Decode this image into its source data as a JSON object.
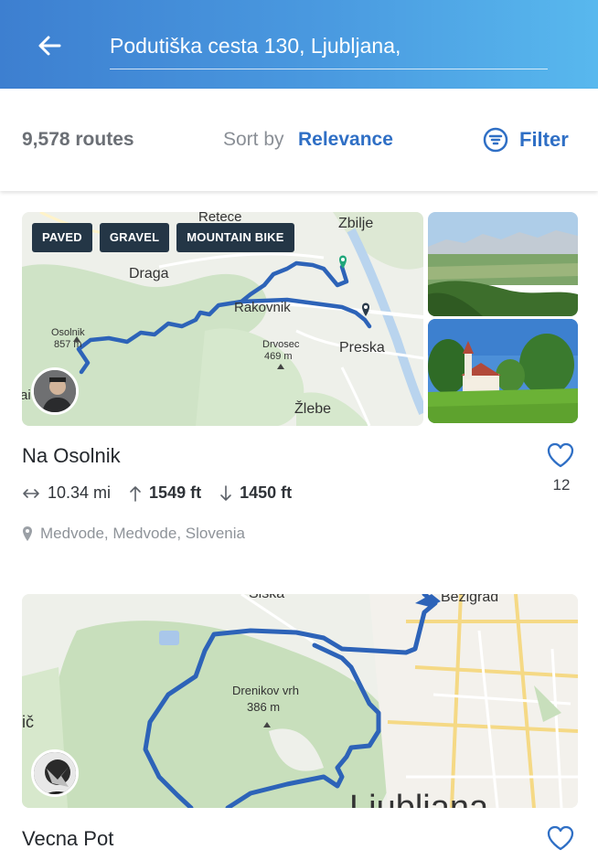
{
  "header": {
    "search_value": "Podutiška cesta 130, Ljubljana,",
    "back_icon": "arrow-left-icon"
  },
  "sortbar": {
    "routes_count": "9,578 routes",
    "sort_label": "Sort by",
    "sort_value": "Relevance",
    "filter_label": "Filter"
  },
  "routes": [
    {
      "title": "Na Osolnik",
      "tags": [
        "PAVED",
        "GRAVEL",
        "MOUNTAIN BIKE"
      ],
      "distance": "10.34 mi",
      "elevation_gain": "1549 ft",
      "elevation_loss": "1450 ft",
      "location": "Medvode, Medvode, Slovenia",
      "likes": "12",
      "map_labels": {
        "retece": "Retece",
        "zbilje": "Zbilje",
        "draga": "Draga",
        "rakovnik": "Rakovnik",
        "osolnik": "Osolnik",
        "osolnik_elev": "857 m",
        "drvosec": "Drvosec",
        "drvosec_elev": "469 m",
        "preska": "Preska",
        "zlebe": "Žlebe",
        "edge_left": "ai"
      }
    },
    {
      "title": "Vecna Pot",
      "map_labels": {
        "siska": "Šiška",
        "bezigrad": "Bežigrad",
        "drenikov": "Drenikov vrh",
        "drenikov_elev": "386 m",
        "edge_left": "ič",
        "ljubljana": "Ljubljana"
      }
    }
  ],
  "colors": {
    "accent": "#2f6fc5",
    "route_line": "#2d63b8",
    "chip_bg": "#243646"
  }
}
